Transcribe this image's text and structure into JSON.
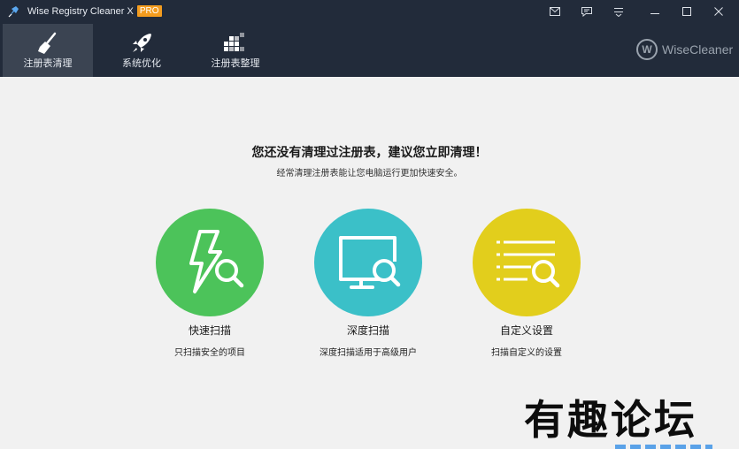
{
  "window": {
    "title": "Wise Registry Cleaner X",
    "badge": "PRO",
    "controls": [
      "mail-icon",
      "feedback-icon",
      "settings-menu-icon",
      "minimize-icon",
      "maximize-icon",
      "close-icon"
    ]
  },
  "nav": {
    "tabs": [
      {
        "label": "注册表清理",
        "icon": "broom-icon",
        "active": true
      },
      {
        "label": "系统优化",
        "icon": "rocket-icon",
        "active": false
      },
      {
        "label": "注册表整理",
        "icon": "defrag-icon",
        "active": false
      }
    ]
  },
  "brand": {
    "mark": "W",
    "name": "WiseCleaner"
  },
  "main": {
    "headline": "您还没有清理过注册表，建议您立即清理！",
    "subline": "经常清理注册表能让您电脑运行更加快速安全。",
    "options": [
      {
        "title": "快速扫描",
        "desc": "只扫描安全的项目",
        "icon": "lightning-search-icon",
        "color": "#4cc35a"
      },
      {
        "title": "深度扫描",
        "desc": "深度扫描适用于高级用户",
        "icon": "monitor-search-icon",
        "color": "#3bc0c8"
      },
      {
        "title": "自定义设置",
        "desc": "扫描自定义的设置",
        "icon": "list-search-icon",
        "color": "#e2ce1c"
      }
    ]
  },
  "watermark": "有趣论坛",
  "colors": {
    "header_bg": "#222b3a",
    "tab_active_bg": "#3b4452",
    "pro_badge": "#f39c1f",
    "body_bg": "#f1f1f1"
  }
}
